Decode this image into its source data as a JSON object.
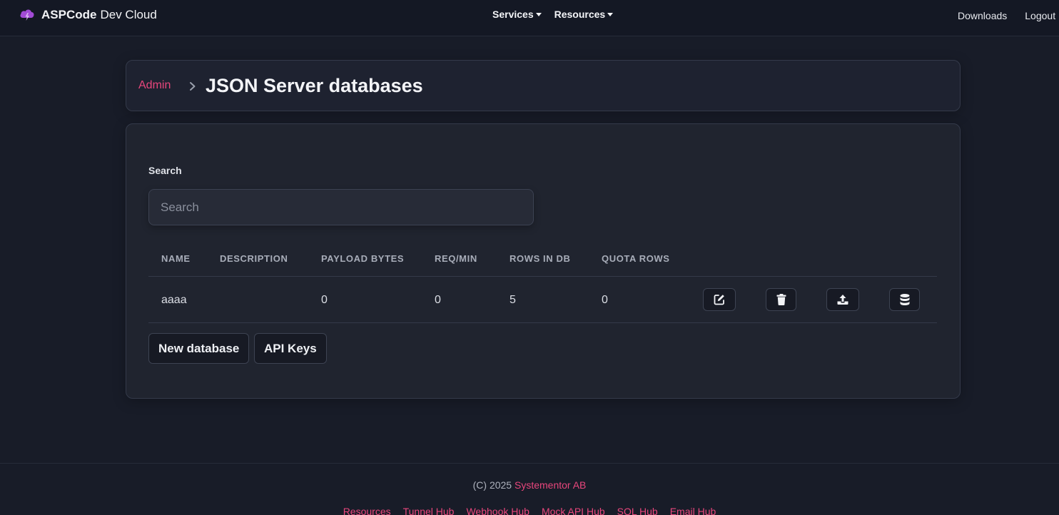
{
  "nav": {
    "brand_bold": "ASPCode",
    "brand_rest": "Dev Cloud",
    "menus": [
      "Services",
      "Resources"
    ],
    "right_links": [
      "Downloads",
      "Logout"
    ]
  },
  "breadcrumb": {
    "parent": "Admin",
    "title": "JSON Server databases"
  },
  "search": {
    "label": "Search",
    "placeholder": "Search",
    "value": ""
  },
  "table": {
    "headers": [
      "NAME",
      "DESCRIPTION",
      "PAYLOAD BYTES",
      "REQ/MIN",
      "ROWS IN DB",
      "QUOTA ROWS"
    ],
    "rows": [
      {
        "name": "aaaa",
        "description": "",
        "payload_bytes": "0",
        "req_min": "0",
        "rows_in_db": "5",
        "quota_rows": "0",
        "actions": [
          "edit-icon",
          "trash-icon",
          "upload-icon",
          "database-icon"
        ]
      }
    ]
  },
  "buttons": {
    "new_database": "New database",
    "api_keys": "API Keys"
  },
  "footer": {
    "copyright_prefix": "(C) 2025",
    "company": "Systementor AB",
    "links": [
      "Resources",
      "Tunnel Hub",
      "Webhook Hub",
      "Mock API Hub",
      "SQL Hub",
      "Email Hub"
    ]
  },
  "colors": {
    "accent": "#e8467c",
    "logo": "#a24bd6",
    "background": "#181c28"
  }
}
